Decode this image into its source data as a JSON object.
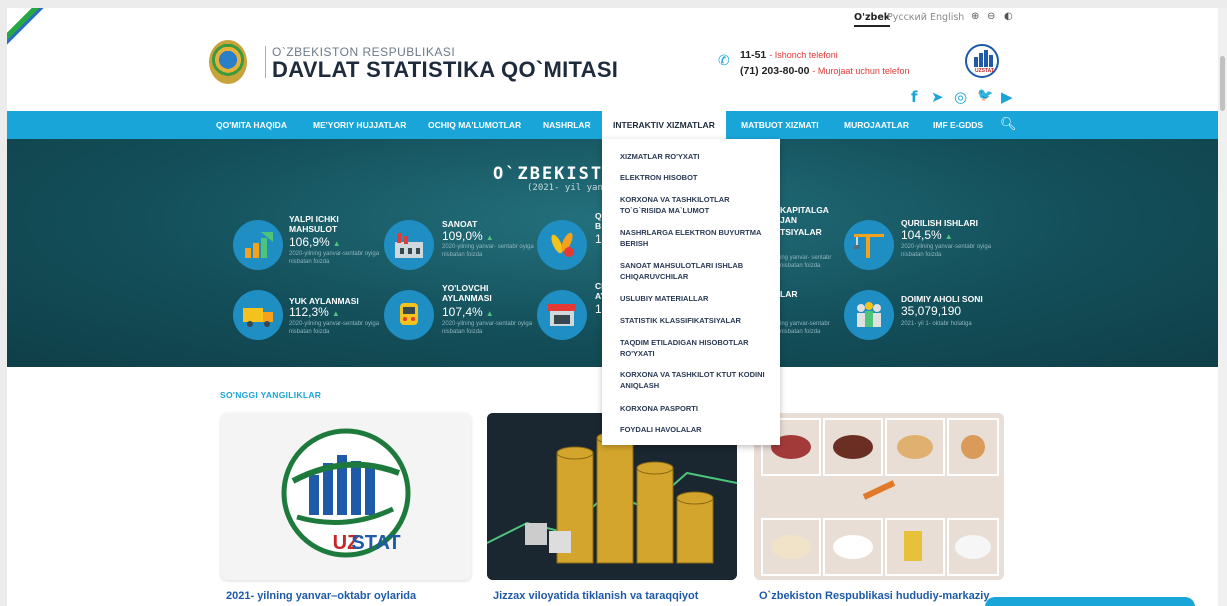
{
  "languages": [
    {
      "label": "O'zbek",
      "active": true
    },
    {
      "label": "Русский",
      "active": false
    },
    {
      "label": "English",
      "active": false
    }
  ],
  "toolbar": {
    "zoom_in": "⊕",
    "zoom_out": "⊖",
    "contrast": "◐"
  },
  "brand": {
    "subtitle": "O`ZBEKISTON RESPUBLIKASI",
    "title": "DAVLAT STATISTIKA QO`MITASI"
  },
  "contacts": {
    "hotline_number": "11-51",
    "hotline_label": "- Ishonch telefoni",
    "phone_number": "(71) 203-80-00",
    "phone_label": "- Murojaat uchun telefon"
  },
  "logo_text": "UZSTAT",
  "social": [
    "f",
    "➤",
    "◎",
    "🐦",
    "▶"
  ],
  "nav": [
    "QO'MITA HAQIDA",
    "ME'YORIY HUJJATLAR",
    "OCHIQ MA'LUMOTLAR",
    "NASHRLAR",
    "INTERAKTIV XIZMATLAR",
    "MATBUOT XIZMATI",
    "MUROJAATLAR",
    "IMF E-GDDS"
  ],
  "hero": {
    "title": "O`ZBEKISTON",
    "subtitle": "(2021- yil yanv"
  },
  "stats": {
    "gdp": {
      "label": "YALPI ICHKI MAHSULOT",
      "value": "106,9%",
      "note": "2020-yilning yanvar-sentabr oyiga nisbatan foizda"
    },
    "industry": {
      "label": "SANOAT",
      "value": "109,0%",
      "note": "2020-yilning yanvar- sentabr oyiga nisbatan foizda"
    },
    "agri": {
      "label": "Q",
      "label2": "B",
      "value": "1"
    },
    "capital": {
      "label": "KAPITALGA",
      "label2": "JAN",
      "label3": "TSIYALAR",
      "note": "ing yanvar- sentabr",
      "note2": "nisbatan foizda"
    },
    "construction": {
      "label": "QURILISH ISHLARI",
      "value": "104,5%",
      "note": "2020-yilning yanvar-sentabr oyiga nisbatan foizda"
    },
    "cargo": {
      "label": "YUK AYLANMASI",
      "value": "112,3%",
      "note": "2020-yilning yanvar-sentabr oyiga nisbatan foizda"
    },
    "passenger": {
      "label": "YO'LOVCHI AYLANMASI",
      "value": "107,4%",
      "note": "2020-yilning yanvar-sentabr oyiga nisbatan foizda"
    },
    "trade": {
      "label": "CH",
      "label2": "AY",
      "value": "1"
    },
    "services": {
      "label": "LAR",
      "note": "ing yanvar-sentabr",
      "note2": "nisbatan foizda"
    },
    "population": {
      "label": "DOIMIY AHOLI SONI",
      "value": "35,079,190",
      "note": "2021- yil 1- oktabr holatiga"
    }
  },
  "dropdown": [
    "XIZMATLAR RO'YXATI",
    "ELEKTRON HISOBOT",
    "KORXONA VA TASHKILOTLAR TO`G`RISIDA MA`LUMOT",
    "NASHRLARGA ELEKTRON BUYURTMA BERISH",
    "SANOAT MAHSULOTLARI ISHLAB CHIQARUVCHILAR",
    "USLUBIY MATERIALLAR",
    "STATISTIK KLASSIFIKATSIYALAR",
    "TAQDIM ETILADIGAN HISOBOTLAR RO'YXATI",
    "KORXONA VA TASHKILOT KTUT KODINI ANIQLASH",
    "KORXONA PASPORTI",
    "FOYDALI HAVOLALAR"
  ],
  "news": {
    "heading": "SO'NGGI YANGILIKLAR",
    "items": [
      {
        "title": "2021- yilning yanvar–oktabr oylarida"
      },
      {
        "title": "Jizzax viloyatida tiklanish va taraqqiyot"
      },
      {
        "title": "O`zbekiston Respublikasi hududiy-markaziy"
      }
    ]
  },
  "colors": {
    "accent": "#1aa5d9",
    "hero_bg": "#134f5a",
    "positive": "#4ec37a",
    "title": "#1e2b3c"
  }
}
